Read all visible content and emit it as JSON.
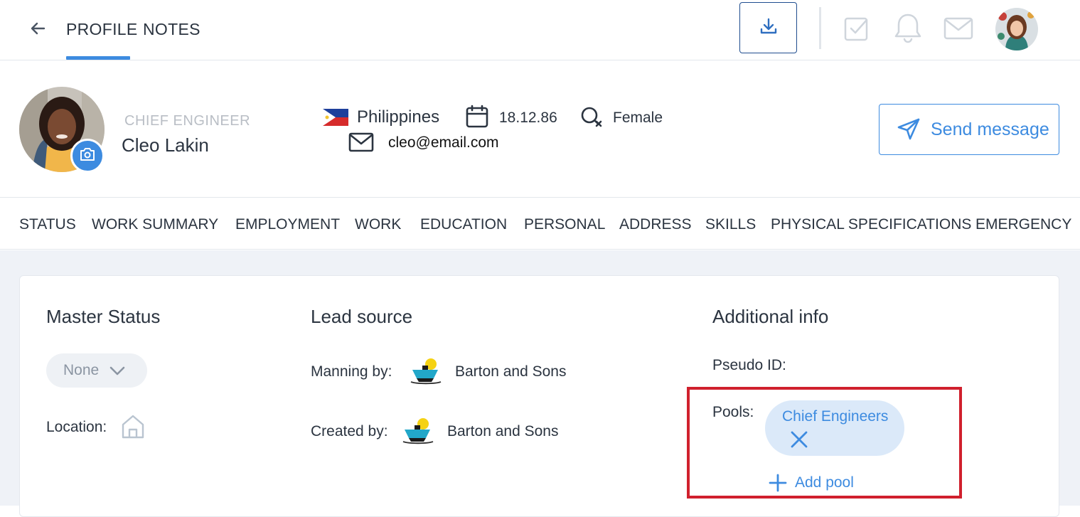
{
  "topbar": {
    "tabs": [
      {
        "label": "PROFILE",
        "active": true
      },
      {
        "label": "NOTES",
        "active": false
      }
    ],
    "icons": [
      "back-arrow-icon",
      "download-icon",
      "tasks-check-icon",
      "bell-icon",
      "mail-icon",
      "user-avatar"
    ]
  },
  "profile": {
    "role": "CHIEF ENGINEER",
    "name": "Cleo Lakin",
    "country": "Philippines",
    "date_of_birth": "18.12.86",
    "gender": "Female",
    "email": "cleo@email.com",
    "send_message_label": "Send message"
  },
  "section_nav": [
    "STATUS",
    "WORK SUMMARY",
    "EMPLOYMENT",
    "WORK",
    "EDUCATION",
    "PERSONAL",
    "ADDRESS",
    "SKILLS",
    "PHYSICAL SPECIFICATIONS",
    "EMERGENCY"
  ],
  "master_status": {
    "heading": "Master Status",
    "select_value": "None",
    "location_label": "Location:"
  },
  "lead_source": {
    "heading": "Lead source",
    "manning_label": "Manning by:",
    "manning_value": "Barton and Sons",
    "created_label": "Created by:",
    "created_value": "Barton and Sons"
  },
  "additional_info": {
    "heading": "Additional info",
    "pseudo_id_label": "Pseudo ID:",
    "pools_label": "Pools:",
    "pools": [
      "Chief Engineers"
    ],
    "add_pool_label": "Add pool"
  },
  "colors": {
    "accent": "#3d8be0",
    "text": "#2b3440",
    "muted": "#b9bec5",
    "highlight": "#d0202d",
    "chip_bg": "#dbe9f9",
    "content_bg": "#eff2f7"
  }
}
